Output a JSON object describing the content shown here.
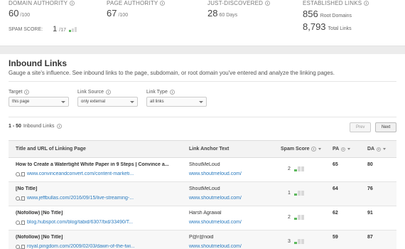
{
  "metrics": {
    "domain_authority": {
      "label": "DOMAIN AUTHORITY",
      "value": "60",
      "suffix": "/100"
    },
    "page_authority": {
      "label": "PAGE AUTHORITY",
      "value": "67",
      "suffix": "/100"
    },
    "just_discovered": {
      "label": "JUST-DISCOVERED",
      "value": "28",
      "suffix": "60 Days"
    },
    "established_links": {
      "label": "ESTABLISHED LINKS",
      "root_value": "856",
      "root_label": "Root Domains",
      "total_value": "8,793",
      "total_label": "Total Links"
    },
    "spam_score": {
      "label": "SPAM SCORE:",
      "value": "1",
      "suffix": "/17"
    }
  },
  "inbound": {
    "title": "Inbound Links",
    "description": "Gauge a site's influence. See inbound links to the page, subdomain, or root domain you've entered and analyze the linking pages.",
    "filters": {
      "target": {
        "label": "Target",
        "value": "this page"
      },
      "link_source": {
        "label": "Link Source",
        "value": "only external"
      },
      "link_type": {
        "label": "Link Type",
        "value": "all links"
      }
    },
    "count": {
      "range": "1 - 50",
      "label": "Inbound Links"
    },
    "prev_label": "Prev",
    "next_label": "Next",
    "columns": {
      "title": "Title and URL of Linking Page",
      "anchor": "Link Anchor Text",
      "spam": "Spam Score",
      "pa": "PA",
      "da": "DA"
    },
    "rows": [
      {
        "title": "How to Create a Watertight White Paper in 9 Steps | Convince a...",
        "url": "www.convinceandconvert.com/content-marketi...",
        "anchor": "ShoutMeLoud",
        "anchor_domain": "www.shoutmeloud.com/",
        "spam": "2",
        "pa": "65",
        "da": "80"
      },
      {
        "title": "[No Title]",
        "url": "www.jeffbullas.com/2016/09/15/live-streaming-...",
        "anchor": "ShoutMeLoud",
        "anchor_domain": "www.shoutmeloud.com/",
        "spam": "1",
        "pa": "64",
        "da": "76"
      },
      {
        "title": "(Nofollow) [No Title]",
        "url": "blog.hubspot.com/blog/tabid/6307/bid/33490/T...",
        "anchor": "Harsh Agrawal",
        "anchor_domain": "www.shoutmeloud.com/",
        "spam": "2",
        "pa": "62",
        "da": "91"
      },
      {
        "title": "(Nofollow) [No Title]",
        "url": "royal.pingdom.com/2009/02/03/dawn-of-the-twi...",
        "anchor": "P@r@noid",
        "anchor_domain": "www.shoutmeloud.com/",
        "spam": "3",
        "pa": "59",
        "da": "87"
      }
    ]
  }
}
